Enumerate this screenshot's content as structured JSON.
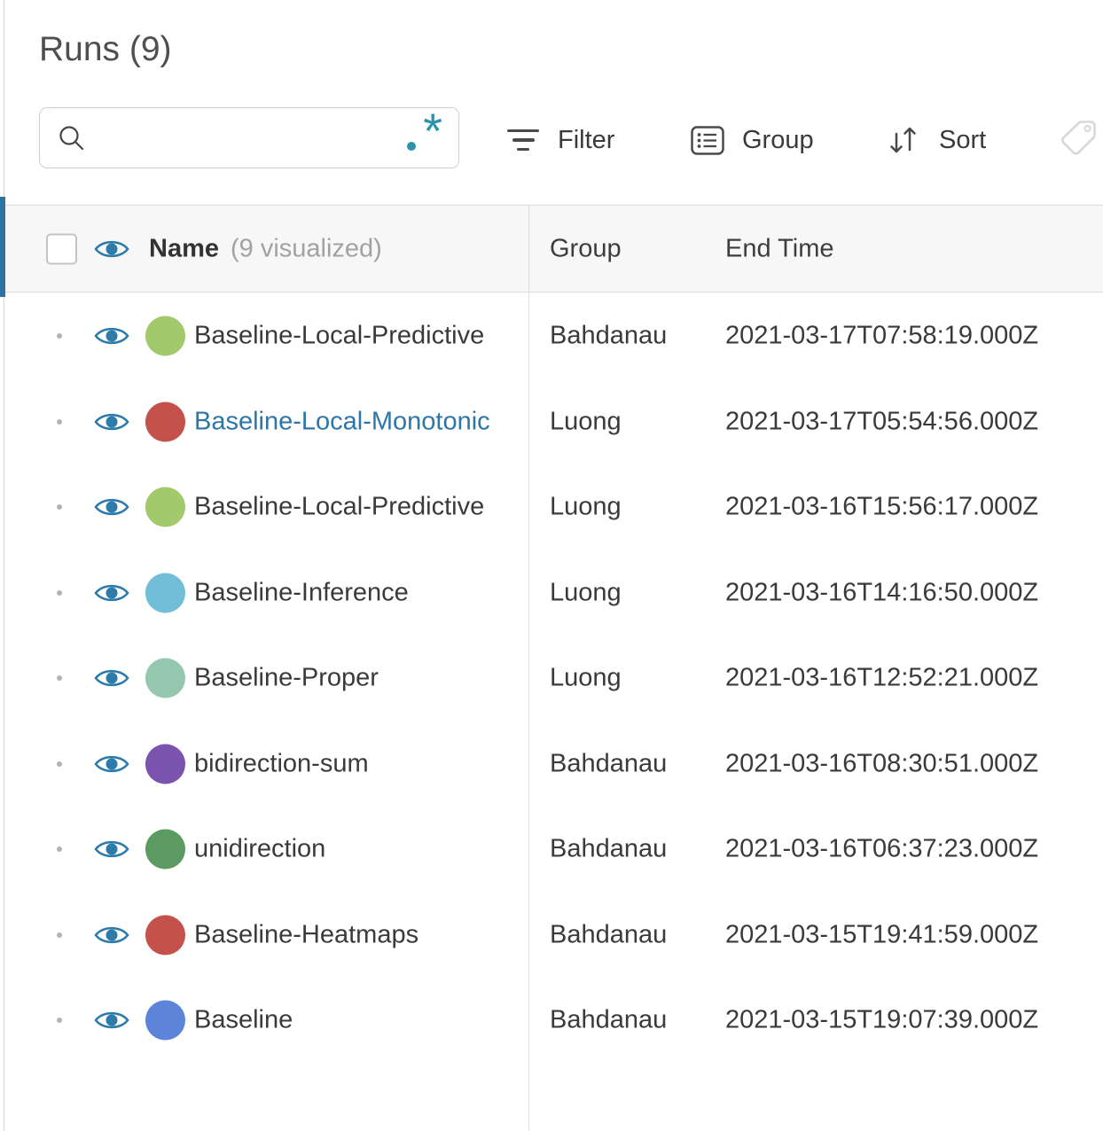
{
  "header": {
    "title": "Runs (9)",
    "search": {
      "value": "",
      "placeholder": ""
    },
    "toolbar": {
      "filter": "Filter",
      "group": "Group",
      "sort": "Sort"
    }
  },
  "icons": {
    "search": "magnifier",
    "regex": ".*",
    "filter": "funnel-lines",
    "group": "bullet-list-box",
    "sort": "down-up-arrows",
    "tag": "tag-outline",
    "visibility": "eye"
  },
  "colors": {
    "accent_bar": "#2e74a3",
    "link_blue": "#2d76a8",
    "eye_blue": "#2d7bab",
    "regex_teal": "#2a96ab",
    "header_bg": "#f7f7f7"
  },
  "table": {
    "columns": {
      "name": "Name",
      "name_annotation": "(9 visualized)",
      "group": "Group",
      "end_time": "End Time"
    },
    "rows": [
      {
        "visible": true,
        "dot_color": "#a2c96c",
        "name": "Baseline-Local-Predictive",
        "name_is_link": false,
        "group": "Bahdanau",
        "end_time": "2021-03-17T07:58:19.000Z"
      },
      {
        "visible": true,
        "dot_color": "#c5514d",
        "name": "Baseline-Local-Monotonic",
        "name_is_link": true,
        "group": "Luong",
        "end_time": "2021-03-17T05:54:56.000Z"
      },
      {
        "visible": true,
        "dot_color": "#a2c96c",
        "name": "Baseline-Local-Predictive",
        "name_is_link": false,
        "group": "Luong",
        "end_time": "2021-03-16T15:56:17.000Z"
      },
      {
        "visible": true,
        "dot_color": "#72bed8",
        "name": "Baseline-Inference",
        "name_is_link": false,
        "group": "Luong",
        "end_time": "2021-03-16T14:16:50.000Z"
      },
      {
        "visible": true,
        "dot_color": "#94c7ae",
        "name": "Baseline-Proper",
        "name_is_link": false,
        "group": "Luong",
        "end_time": "2021-03-16T12:52:21.000Z"
      },
      {
        "visible": true,
        "dot_color": "#7b53ae",
        "name": "bidirection-sum",
        "name_is_link": false,
        "group": "Bahdanau",
        "end_time": "2021-03-16T08:30:51.000Z"
      },
      {
        "visible": true,
        "dot_color": "#5b9b62",
        "name": "unidirection",
        "name_is_link": false,
        "group": "Bahdanau",
        "end_time": "2021-03-16T06:37:23.000Z"
      },
      {
        "visible": true,
        "dot_color": "#c5514d",
        "name": "Baseline-Heatmaps",
        "name_is_link": false,
        "group": "Bahdanau",
        "end_time": "2021-03-15T19:41:59.000Z"
      },
      {
        "visible": true,
        "dot_color": "#5c85da",
        "name": "Baseline",
        "name_is_link": false,
        "group": "Bahdanau",
        "end_time": "2021-03-15T19:07:39.000Z"
      }
    ]
  }
}
